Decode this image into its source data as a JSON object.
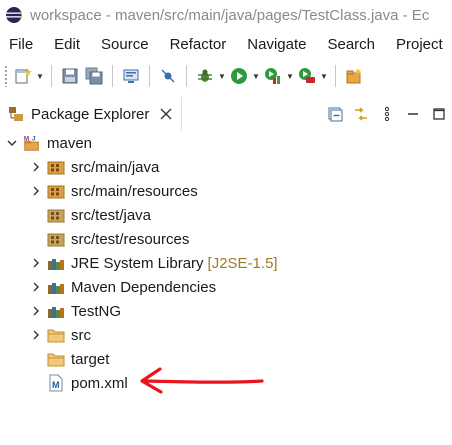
{
  "window": {
    "title": "workspace - maven/src/main/java/pages/TestClass.java - Ec"
  },
  "menu": [
    "File",
    "Edit",
    "Source",
    "Refactor",
    "Navigate",
    "Search",
    "Project"
  ],
  "toolbar": {
    "icons": [
      "new-wizard-icon",
      "save-icon",
      "save-all-icon",
      "open-console-icon",
      "skip-breakpoints-icon",
      "debug-icon",
      "run-icon",
      "coverage-icon",
      "external-tools-icon",
      "new-java-project-icon"
    ]
  },
  "view": {
    "title": "Package Explorer"
  },
  "tree": {
    "project": "maven",
    "items": [
      {
        "label": "src/main/java",
        "icon": "source-folder-icon"
      },
      {
        "label": "src/main/resources",
        "icon": "source-folder-icon"
      },
      {
        "label": "src/test/java",
        "icon": "source-folder-icon"
      },
      {
        "label": "src/test/resources",
        "icon": "source-folder-icon"
      },
      {
        "label": "JRE System Library",
        "decoration": "[J2SE-1.5]",
        "icon": "library-icon"
      },
      {
        "label": "Maven Dependencies",
        "icon": "library-icon"
      },
      {
        "label": "TestNG",
        "icon": "library-icon"
      },
      {
        "label": "src",
        "icon": "folder-icon"
      },
      {
        "label": "target",
        "icon": "folder-icon"
      },
      {
        "label": "pom.xml",
        "icon": "maven-pom-file-icon"
      }
    ]
  },
  "colors": {
    "annotation_arrow": "#e8141e",
    "decoration_text": "#9a7b2e"
  }
}
